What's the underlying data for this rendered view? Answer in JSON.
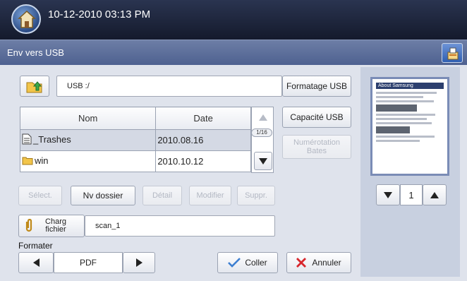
{
  "header": {
    "datetime": "10-12-2010 03:13 PM"
  },
  "title": "Env vers USB",
  "path": {
    "value": "USB :/"
  },
  "buttons": {
    "format_usb": "Formatage USB",
    "usb_capacity": "Capacité USB",
    "bates_numbering": "Numérotation Bates",
    "select": "Sélect.",
    "new_folder": "Nv dossier",
    "detail": "Détail",
    "modify": "Modifier",
    "delete": "Suppr.",
    "load_file": "Charg fichier",
    "paste": "Coller",
    "cancel": "Annuler"
  },
  "table": {
    "headers": [
      "Nom",
      "Date"
    ],
    "rows": [
      {
        "name": "_Trashes",
        "date": "2010.08.16",
        "icon": "file-icon"
      },
      {
        "name": "win",
        "date": "2010.10.12",
        "icon": "folder-icon"
      }
    ],
    "page_counter": "1/16"
  },
  "filename": {
    "value": "scan_1"
  },
  "format": {
    "label": "Formater",
    "value": "PDF"
  },
  "preview": {
    "title": "About Samsung",
    "page": "1"
  },
  "colors": {
    "accent": "#4e6190",
    "selected_row": "#d4d9e4"
  }
}
